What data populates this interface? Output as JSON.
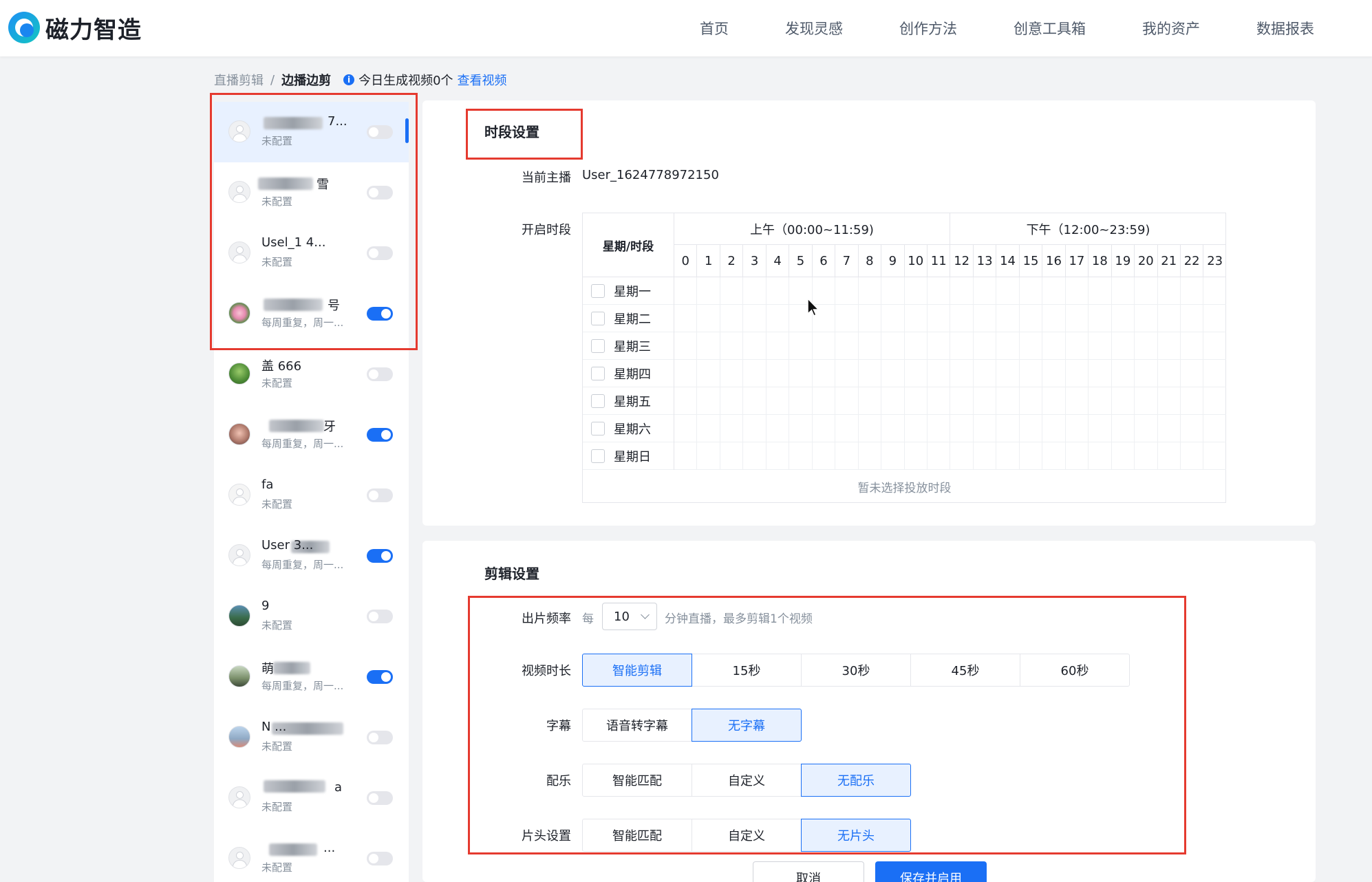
{
  "header": {
    "logo_text": "磁力智造",
    "nav": [
      "首页",
      "发现灵感",
      "创作方法",
      "创意工具箱",
      "我的资产",
      "数据报表"
    ]
  },
  "breadcrumb": {
    "parent": "直播剪辑",
    "separator": "/",
    "current": "边播边剪",
    "info_icon": "i",
    "info_text": "今日生成视频0个",
    "action": "查看视频"
  },
  "anchors": [
    {
      "name": "7...",
      "status": "未配置",
      "enabled": false
    },
    {
      "name": "雪",
      "status": "未配置",
      "enabled": false
    },
    {
      "name": "Usel_1 4...",
      "status": "未配置",
      "enabled": false
    },
    {
      "name": "号",
      "status": "每周重复，周一...",
      "enabled": true
    },
    {
      "name": "盖 666",
      "status": "未配置",
      "enabled": false
    },
    {
      "name": "牙",
      "status": "每周重复，周一...",
      "enabled": true
    },
    {
      "name": "fa",
      "status": "未配置",
      "enabled": false
    },
    {
      "name": "User 3...",
      "status": "每周重复，周一...",
      "enabled": true
    },
    {
      "name": "9",
      "status": "未配置",
      "enabled": false
    },
    {
      "name": "萌",
      "status": "每周重复，周一...",
      "enabled": true
    },
    {
      "name": "N ...",
      "status": "未配置",
      "enabled": false
    },
    {
      "name": "a",
      "status": "未配置",
      "enabled": false
    },
    {
      "name": "...",
      "status": "未配置",
      "enabled": false
    }
  ],
  "time_settings": {
    "title": "时段设置",
    "current_anchor_label": "当前主播",
    "current_anchor_value": "User_1624778972150",
    "period_label": "开启时段",
    "grid_header": "星期/时段",
    "am_label": "上午（00:00~11:59)",
    "pm_label": "下午（12:00~23:59)",
    "hours": [
      "0",
      "1",
      "2",
      "3",
      "4",
      "5",
      "6",
      "7",
      "8",
      "9",
      "10",
      "11",
      "12",
      "13",
      "14",
      "15",
      "16",
      "17",
      "18",
      "19",
      "20",
      "21",
      "22",
      "23"
    ],
    "days": [
      "星期一",
      "星期二",
      "星期三",
      "星期四",
      "星期五",
      "星期六",
      "星期日"
    ],
    "empty_text": "暂未选择投放时段"
  },
  "edit_settings": {
    "title": "剪辑设置",
    "frequency": {
      "label": "出片频率",
      "prefix": "每",
      "value": "10",
      "suffix": "分钟直播，最多剪辑1个视频"
    },
    "duration": {
      "label": "视频时长",
      "options": [
        "智能剪辑",
        "15秒",
        "30秒",
        "45秒",
        "60秒"
      ],
      "selected": 0
    },
    "subtitle": {
      "label": "字幕",
      "options": [
        "语音转字幕",
        "无字幕"
      ],
      "selected": 1
    },
    "music": {
      "label": "配乐",
      "options": [
        "智能匹配",
        "自定义",
        "无配乐"
      ],
      "selected": 2
    },
    "opening": {
      "label": "片头设置",
      "options": [
        "智能匹配",
        "自定义",
        "无片头"
      ],
      "selected": 2
    }
  },
  "footer": {
    "cancel": "取消",
    "save": "保存并启用"
  },
  "colors": {
    "accent": "#1a6ff5",
    "highlight": "#e53a2f"
  }
}
